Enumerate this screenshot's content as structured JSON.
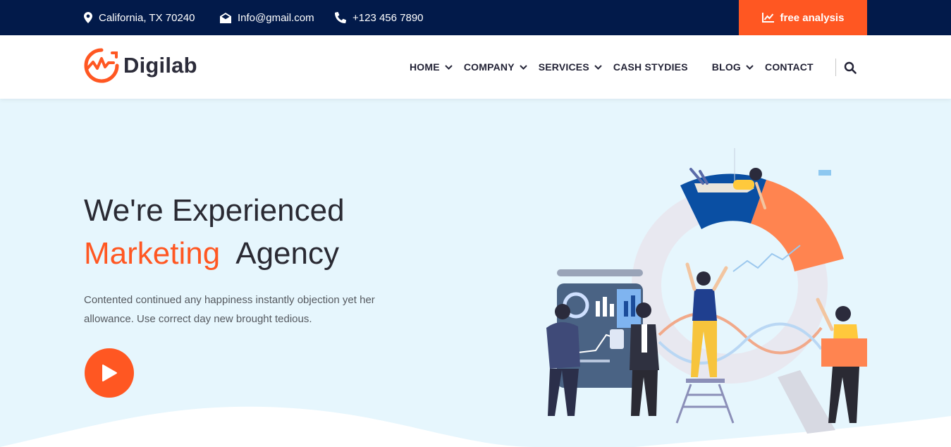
{
  "topbar": {
    "address": "California, TX 70240",
    "email": "Info@gmail.com",
    "phone": "+123 456 7890",
    "cta_label": "free analysis"
  },
  "brand": {
    "name": "Digilab",
    "accent_color": "#ff5722",
    "dark_color": "#021a4a"
  },
  "nav": {
    "items": [
      {
        "label": "HOME",
        "has_dropdown": true
      },
      {
        "label": "COMPANY",
        "has_dropdown": true
      },
      {
        "label": "SERVICES",
        "has_dropdown": true
      },
      {
        "label": "CASH STYDIES",
        "has_dropdown": false
      },
      {
        "label": "BLOG",
        "has_dropdown": true
      },
      {
        "label": "CONTACT",
        "has_dropdown": false
      }
    ],
    "search_icon": "search-icon"
  },
  "hero": {
    "line1": "We're Experienced",
    "accent_word": "Marketing",
    "line2_rest": "Agency",
    "description": "Contented continued any happiness instantly objection yet her allowance. Use correct day new brought tedious.",
    "play_icon": "play-icon"
  }
}
